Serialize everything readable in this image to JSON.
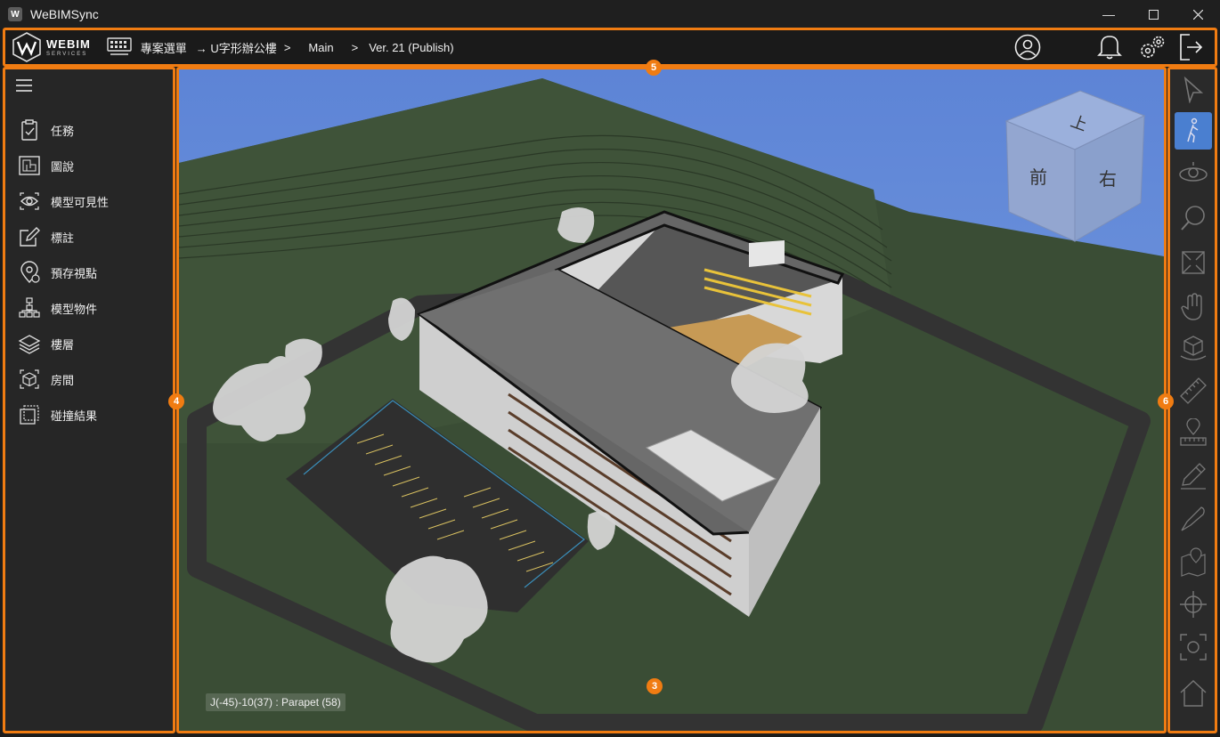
{
  "window": {
    "title": "WeBIMSync",
    "app_icon": "W"
  },
  "logo": {
    "line1": "WEBIM",
    "line2": "SERVICES"
  },
  "breadcrumb": {
    "projects": "專案選單",
    "project": "→ U字形辦公樓",
    "sep1": ">",
    "branch": "Main",
    "sep2": ">",
    "version": "Ver. 21 (Publish)"
  },
  "badges": {
    "viewport": "3",
    "sidebar": "4",
    "header": "5",
    "toolbar": "6"
  },
  "sidebar": {
    "items": [
      {
        "label": "任務",
        "icon": "clipboard-check-icon"
      },
      {
        "label": "圖說",
        "icon": "blueprint-icon"
      },
      {
        "label": "模型可見性",
        "icon": "eye-icon"
      },
      {
        "label": "標註",
        "icon": "edit-icon"
      },
      {
        "label": "預存視點",
        "icon": "map-pin-icon"
      },
      {
        "label": "模型物件",
        "icon": "hierarchy-icon"
      },
      {
        "label": "樓層",
        "icon": "layers-icon"
      },
      {
        "label": "房間",
        "icon": "cube-icon"
      },
      {
        "label": "碰撞結果",
        "icon": "clash-icon"
      }
    ]
  },
  "viewcube": {
    "top": "上",
    "front": "前",
    "right": "右"
  },
  "status_text": "J(-45)-10(37) : Parapet (58)",
  "toolbar": {
    "tools": [
      "select-arrow-icon",
      "walk-icon",
      "orbit-icon",
      "zoom-icon",
      "fit-view-icon",
      "pan-hand-icon",
      "section-box-icon",
      "measure-ruler-icon",
      "location-ruler-icon",
      "pencil-icon",
      "knife-icon",
      "map-marker-icon",
      "crosshair-icon",
      "screenshot-icon",
      "home-icon"
    ],
    "active": "walk-icon"
  },
  "colors": {
    "accent": "#f07c12",
    "active_tool": "#4a7fd0",
    "sky": "#6a8fd8",
    "grass": "#3c5036"
  }
}
